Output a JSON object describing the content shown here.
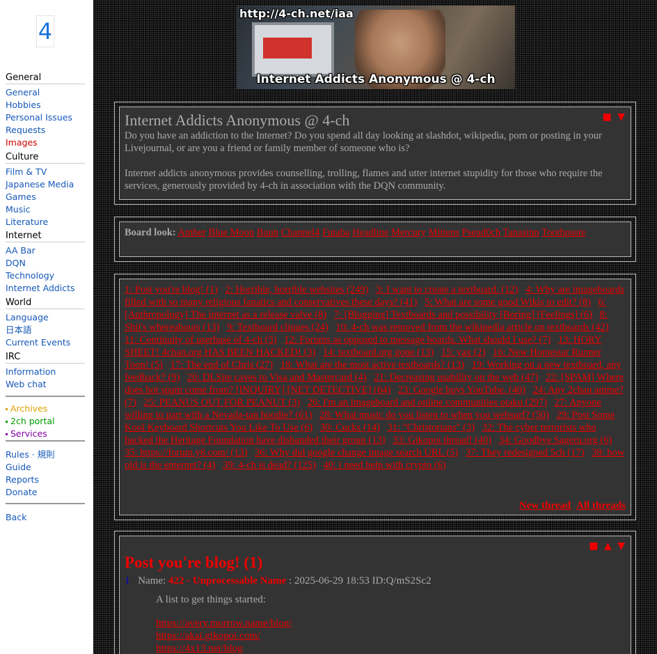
{
  "sidebar": {
    "logo": "4",
    "sections": [
      {
        "heading": "General",
        "links": [
          {
            "label": "General"
          },
          {
            "label": "Hobbies"
          },
          {
            "label": "Personal Issues"
          },
          {
            "label": "Requests"
          },
          {
            "label": "Images",
            "active": true
          }
        ]
      },
      {
        "heading": "Culture",
        "links": [
          {
            "label": "Film & TV"
          },
          {
            "label": "Japanese Media"
          },
          {
            "label": "Games"
          },
          {
            "label": "Music"
          },
          {
            "label": "Literature"
          }
        ]
      },
      {
        "heading": "Internet",
        "links": [
          {
            "label": "AA Bar"
          },
          {
            "label": "DQN"
          },
          {
            "label": "Technology"
          },
          {
            "label": "Internet Addicts"
          }
        ]
      },
      {
        "heading": "World",
        "links": [
          {
            "label": "Language"
          },
          {
            "label": "日本語"
          },
          {
            "label": "Current Events"
          }
        ]
      },
      {
        "heading": "IRC",
        "links": [
          {
            "label": "Information"
          },
          {
            "label": "Web chat"
          }
        ]
      }
    ],
    "extras": [
      {
        "label": "Archives",
        "color": "#e0a000"
      },
      {
        "label": "2ch portal",
        "color": "#009900"
      },
      {
        "label": "Services",
        "color": "#8000a0"
      }
    ],
    "footer": [
      "Rules · 規則",
      "Guide",
      "Reports",
      "Donate"
    ],
    "back": "Back"
  },
  "banner": {
    "url": "http://4-ch.net/iaa",
    "title": "Internet Addicts Anonymous @ 4-ch"
  },
  "intro": {
    "title": "Internet Addicts Anonymous @ 4-ch",
    "p1": "Do you have an addiction to the Internet? Do you spend all day looking at slashdot, wikipedia, porn or posting in your Livejournal, or are you a friend or family member of someone who is?",
    "p2": "Internet addicts anonymous provides counselling, trolling, flames and utter internet stupidity for those who require the services, generously provided by 4-ch in association with the DQN community."
  },
  "styles": {
    "label": "Board look:",
    "items": [
      "Amber",
      "Blue Moon",
      "Buun",
      "Channel4",
      "Futaba",
      "Headline",
      "Mercury",
      "Mittens",
      "Pseud0ch",
      "Tanasinn",
      "Toothpaste"
    ]
  },
  "threads": [
    "1: Post you're blog! (1)",
    "2: Horrible, horrible websites (249)",
    "3: I want to create a textboard. (12)",
    "4: Why are imageboards filled with so many religious fanatics and conservatives these days? (41)",
    "5: What are some good Wikis to edit? (8)",
    "6: [Anthropology] The internet as a release valve (8)",
    "7: [Blogging] Textboards and possibility [Boring] [Feelings] (6)",
    "8: Shii's whereabouts (13)",
    "9: Textboard cliques (24)",
    "10: 4-ch was removed from the wikipedia article on textboards (42)",
    "11: Continuity of userbase of 4-ch (5)",
    "12: Forums as opposed to message boards. What should I use? (7)",
    "13: HORY SHEET! 4chan.org HAS BEEN HACKED! (3)",
    "14: textboard.org gone (13)",
    "15: yax (2)",
    "16: New Homestar Runner Toon! (5)",
    "17: The end of Chris (27)",
    "18: What are the most active textboards? (13)",
    "19: Working on a new textboard, any feedback? (9)",
    "20: DLSite caves to Visa and Mastercard (4)",
    "21: Decreasing usability on the web (47)",
    "22: [SPAM] Where does bot spam come from? [INQUIRY] [NET DETECTIVE] (64)",
    "23: Google buys YouTube. (40)",
    "24: Any 2chan anime? (7)",
    "25: PEANUS OUT FOR PEANUT (3)",
    "26: I'm an imageboard and online communities otaku (297)",
    "27: Anyone willing to part with a Nevada-tan hoodie? (61)",
    "28: What music do you listen to when you websurf? (50)",
    "29: Post Some Kool Keyboard Shortcuts You Like To Use (6)",
    "30: Cucks (14)",
    "31: \"Christorians\" (3)",
    "32: The cyber terrorists who hacked the Heritage Foundation have disbanded their group (13)",
    "33: Gikopoi thread! (40)",
    "34: Goodbye Sageru.org (6)",
    "35: https://forum.y8.com/ (13)",
    "36: Why did google change image search URL (5)",
    "37: They redesigned 5ch (17)",
    "38: how old is the enternet? (4)",
    "39: 4-ch is dead? (125)",
    "40: i need help with crypto (6)"
  ],
  "thread_actions": {
    "new": "New thread",
    "all": "All threads"
  },
  "nav_glyphs": {
    "square": "■",
    "up": "▲",
    "down": "▼"
  },
  "post": {
    "title": "Post you're blog! (1)",
    "number": "1",
    "name_label": "Name:",
    "name": "422 - Unprocessable Name",
    "meta": ": 2025-06-29 18:53 ID:Q/mS2Sc2",
    "body_text": "A list to get things started:",
    "links": [
      "https://avery.morrow.name/blog/",
      "https://akai.gikopoi.com/",
      "https://4x13.net/blog"
    ]
  }
}
